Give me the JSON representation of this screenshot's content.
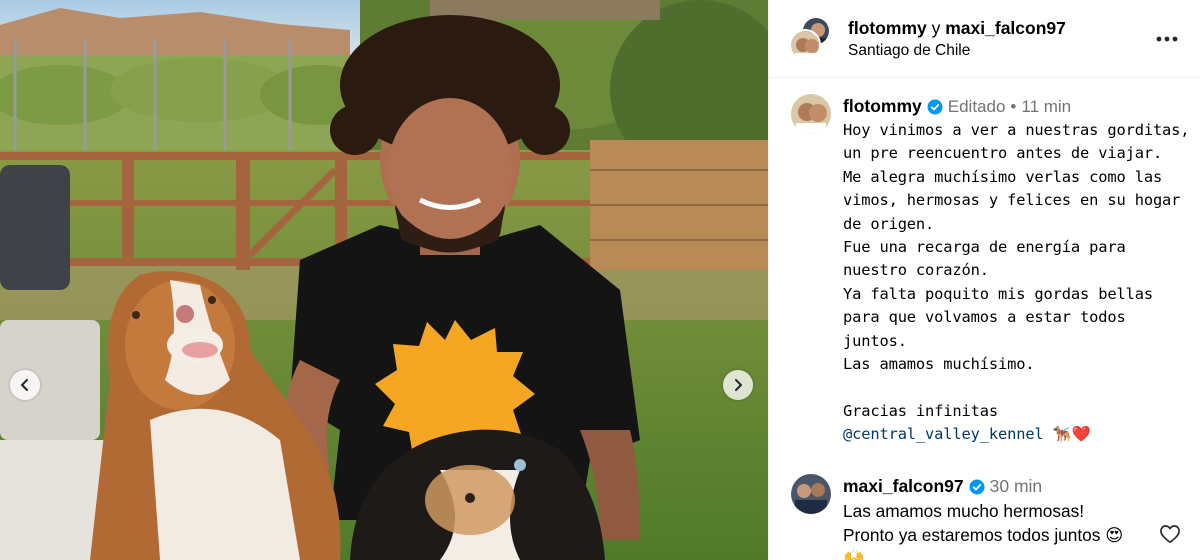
{
  "header": {
    "user1": "flotommy",
    "and_text": "y",
    "user2": "maxi_falcon97",
    "location": "Santiago de Chile"
  },
  "caption": {
    "username": "flotommy",
    "edited": "Editado",
    "separator": "•",
    "time": "11 min",
    "lines": [
      "Hoy vinimos a ver a nuestras gorditas,",
      "un pre reencuentro antes de viajar.",
      "Me alegra muchísimo verlas como las",
      "vimos, hermosas y felices en su hogar",
      "de origen.",
      "Fue una recarga de energía para",
      "nuestro corazón.",
      "Ya falta poquito mis gordas bellas",
      "para que volvamos a estar todos",
      "juntos.",
      "Las amamos muchísimo.",
      "",
      "Gracias infinitas"
    ],
    "mention": "@central_valley_kennel",
    "emoji": "🐕‍🦺❤️"
  },
  "comment": {
    "username": "maxi_falcon97",
    "time": "30 min",
    "line1": "Las amamos mucho hermosas!",
    "line2": "Pronto ya estaremos todos juntos 😍",
    "line3": "🙌"
  },
  "icons": {
    "prev": "chevron-left-icon",
    "next": "chevron-right-icon",
    "more": "more-options-icon",
    "verified": "verified-badge-icon",
    "like": "heart-icon"
  },
  "colors": {
    "verified": "#0095f6",
    "meta": "#737373",
    "mention": "#00376b"
  }
}
